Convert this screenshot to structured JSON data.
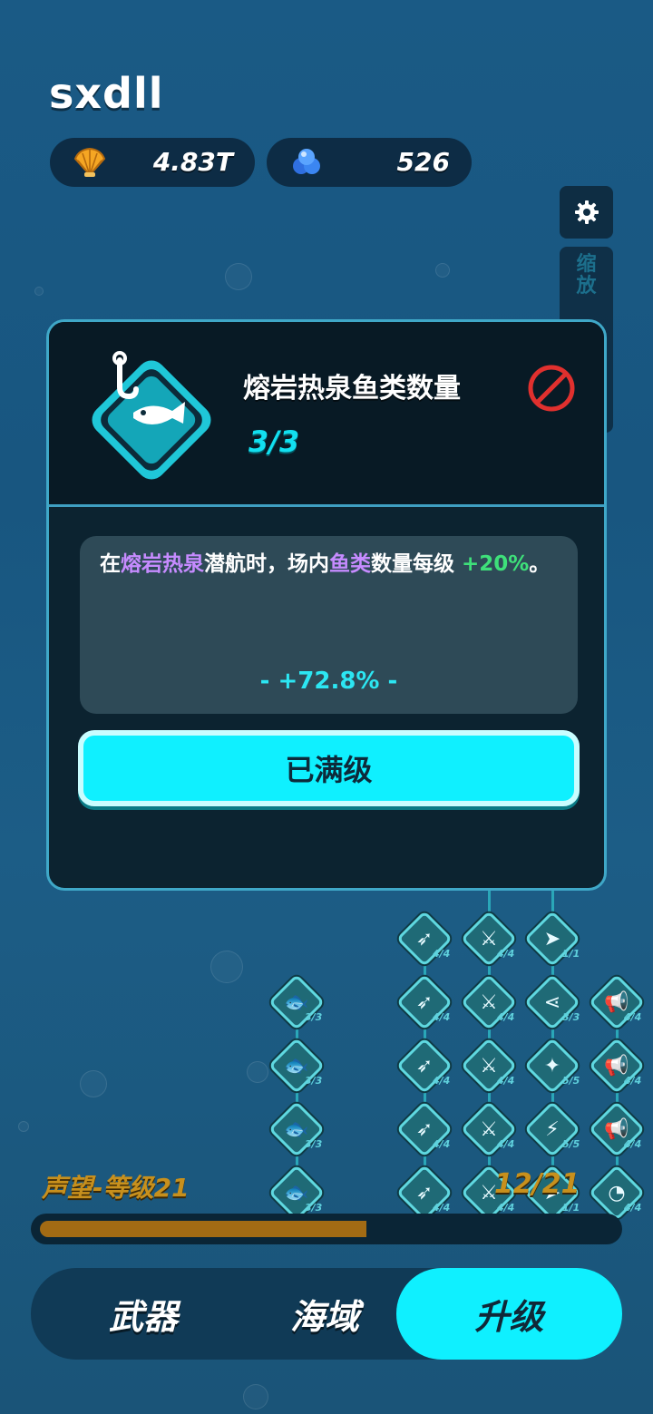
{
  "player": {
    "name": "sxdll"
  },
  "currencies": [
    {
      "icon": "shell-icon",
      "value": "4.83T"
    },
    {
      "icon": "pearl-icon",
      "value": "526"
    }
  ],
  "side_buttons": {
    "settings_icon": "gear-icon",
    "zoom_label": "缩放"
  },
  "popup": {
    "title": "熔岩热泉鱼类数量",
    "level": "3/3",
    "locked_icon": "prohibited-icon",
    "description": {
      "prefix": "在",
      "zone": "熔岩热泉",
      "mid": "潜航时，场内",
      "target": "鱼类",
      "suffix": "数量每级 ",
      "bonus": "+20%",
      "end": "。"
    },
    "total": "- +72.8% -",
    "button_label": "已满级"
  },
  "tree": {
    "levels": [
      "4/4",
      "4/4",
      "1/1",
      "3/3",
      "4/4",
      "4/4",
      "3/3",
      "4/4",
      "3/3",
      "4/4",
      "4/4",
      "5/5",
      "4/4",
      "3/3",
      "4/4",
      "4/4",
      "5/5",
      "4/4",
      "3/3",
      "4/4",
      "4/4",
      "1/1",
      "4/4"
    ]
  },
  "reputation": {
    "label": "声望-等级21",
    "count": "12/21",
    "progress": 0.57
  },
  "nav": {
    "tabs": [
      "武器",
      "海域",
      "升级"
    ],
    "active": "升级"
  },
  "colors": {
    "accent": "#0ff0ff",
    "gold": "#c7901d",
    "purple": "#c68bff",
    "green": "#3ee07a"
  }
}
